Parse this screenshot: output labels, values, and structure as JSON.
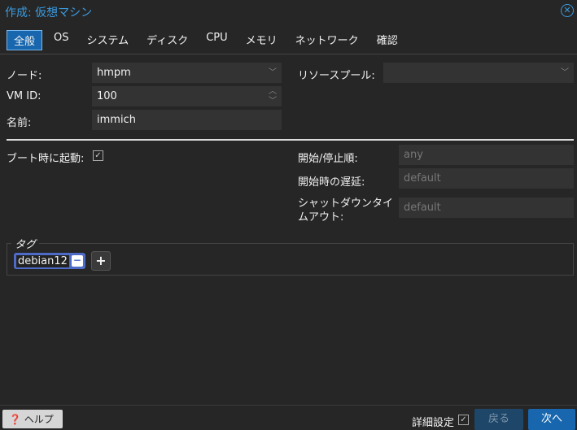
{
  "title": "作成: 仮想マシン",
  "tabs": [
    "全般",
    "OS",
    "システム",
    "ディスク",
    "CPU",
    "メモリ",
    "ネットワーク",
    "確認"
  ],
  "form": {
    "node_label": "ノード:",
    "node_value": "hmpm",
    "vmid_label": "VM ID:",
    "vmid_value": "100",
    "name_label": "名前:",
    "name_value": "immich",
    "pool_label": "リソースプール:",
    "pool_value": "",
    "onboot_label": "ブート時に起動:",
    "order_label": "開始/停止順:",
    "order_placeholder": "any",
    "delay_label": "開始時の遅延:",
    "delay_placeholder": "default",
    "shutdown_label1": "シャットダウンタイ",
    "shutdown_label2": "ムアウト:",
    "shutdown_placeholder": "default"
  },
  "tags": {
    "legend": "タグ",
    "items": [
      "debian12"
    ]
  },
  "footer": {
    "help": "ヘルプ",
    "advanced": "詳細設定",
    "back": "戻る",
    "next": "次へ"
  }
}
